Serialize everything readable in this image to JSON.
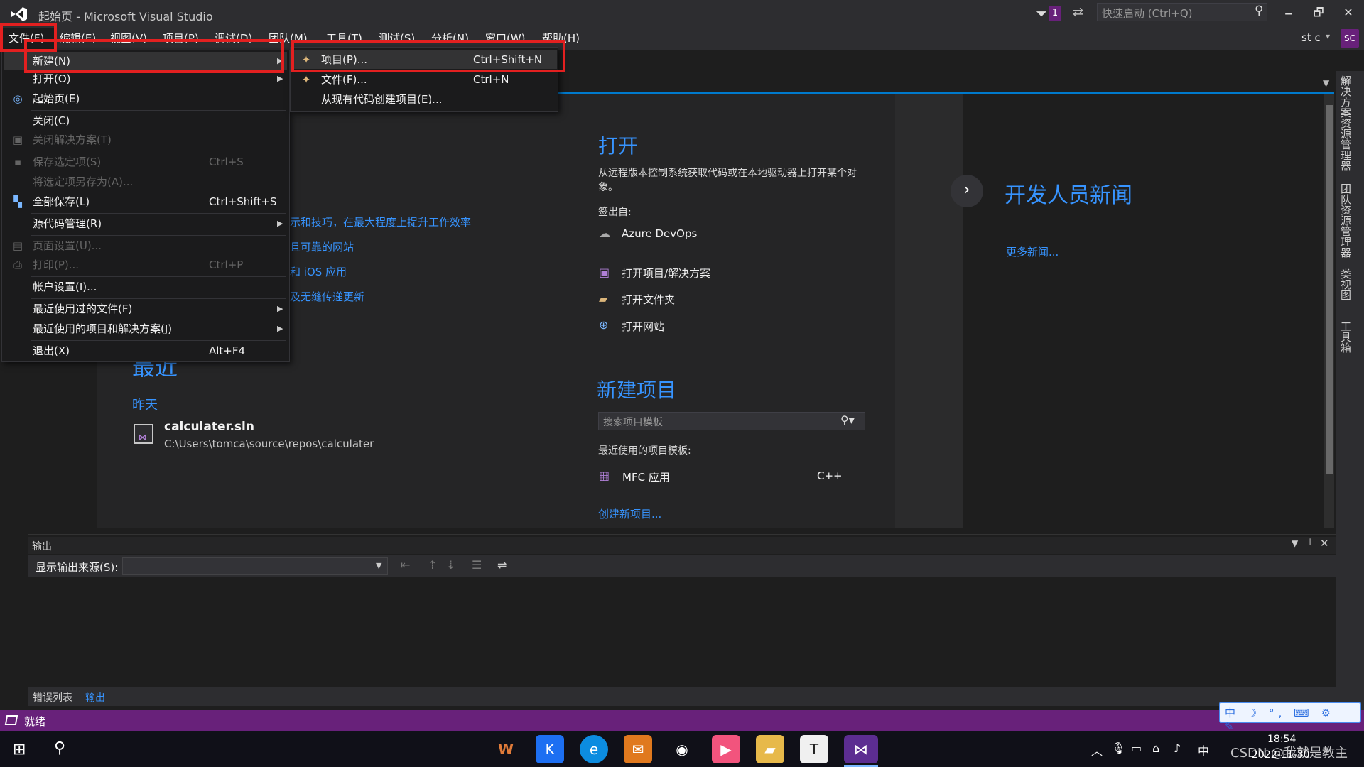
{
  "window": {
    "title": "起始页 - Microsoft Visual Studio",
    "notification_count": "1",
    "quick_launch_placeholder": "快速启动 (Ctrl+Q)",
    "minimize": "🗕",
    "restore": "🗗",
    "close": "✕"
  },
  "menubar": {
    "items": [
      "文件(F)",
      "编辑(E)",
      "视图(V)",
      "项目(P)",
      "调试(D)",
      "团队(M)",
      "工具(T)",
      "测试(S)",
      "分析(N)",
      "窗口(W)",
      "帮助(H)"
    ],
    "user_name": "st c",
    "avatar_initials": "SC"
  },
  "file_menu": {
    "items": [
      {
        "label": "新建(N)",
        "shortcut": "",
        "submenu": true,
        "disabled": false,
        "icon": ""
      },
      {
        "label": "打开(O)",
        "shortcut": "",
        "submenu": true,
        "disabled": false,
        "icon": ""
      },
      {
        "label": "起始页(E)",
        "shortcut": "",
        "submenu": false,
        "disabled": false,
        "icon": "start-page-icon"
      },
      {
        "label": "关闭(C)",
        "shortcut": "",
        "submenu": false,
        "disabled": false,
        "icon": ""
      },
      {
        "label": "关闭解决方案(T)",
        "shortcut": "",
        "submenu": false,
        "disabled": true,
        "icon": "close-solution-icon"
      },
      {
        "label": "保存选定项(S)",
        "shortcut": "Ctrl+S",
        "submenu": false,
        "disabled": true,
        "icon": "save-icon"
      },
      {
        "label": "将选定项另存为(A)...",
        "shortcut": "",
        "submenu": false,
        "disabled": true,
        "icon": ""
      },
      {
        "label": "全部保存(L)",
        "shortcut": "Ctrl+Shift+S",
        "submenu": false,
        "disabled": false,
        "icon": "save-all-icon"
      },
      {
        "label": "源代码管理(R)",
        "shortcut": "",
        "submenu": true,
        "disabled": false,
        "icon": ""
      },
      {
        "label": "页面设置(U)...",
        "shortcut": "",
        "submenu": false,
        "disabled": true,
        "icon": "page-setup-icon"
      },
      {
        "label": "打印(P)...",
        "shortcut": "Ctrl+P",
        "submenu": false,
        "disabled": true,
        "icon": "print-icon"
      },
      {
        "label": "帐户设置(I)...",
        "shortcut": "",
        "submenu": false,
        "disabled": false,
        "icon": ""
      },
      {
        "label": "最近使用过的文件(F)",
        "shortcut": "",
        "submenu": true,
        "disabled": false,
        "icon": ""
      },
      {
        "label": "最近使用的项目和解决方案(J)",
        "shortcut": "",
        "submenu": true,
        "disabled": false,
        "icon": ""
      },
      {
        "label": "退出(X)",
        "shortcut": "Alt+F4",
        "submenu": false,
        "disabled": false,
        "icon": ""
      }
    ]
  },
  "new_submenu": {
    "items": [
      {
        "label": "项目(P)...",
        "shortcut": "Ctrl+Shift+N"
      },
      {
        "label": "文件(F)...",
        "shortcut": "Ctrl+N"
      },
      {
        "label": "从现有代码创建项目(E)...",
        "shortcut": ""
      }
    ]
  },
  "start_page": {
    "partial_links": [
      "示和技巧，在最大程度上提升工作效率",
      "且可靠的网站",
      "和 iOS 应用",
      "及无缝传递更新"
    ],
    "recent_heading": "最近",
    "recent_group": "昨天",
    "recent_item": {
      "name": "calculater.sln",
      "path": "C:\\Users\\tomca\\source\\repos\\calculater"
    },
    "open": {
      "heading": "打开",
      "description": "从远程版本控制系统获取代码或在本地驱动器上打开某个对象。",
      "checkout_label": "签出自:",
      "azure": "Azure DevOps",
      "open_project": "打开项目/解决方案",
      "open_folder": "打开文件夹",
      "open_website": "打开网站"
    },
    "new_project": {
      "heading": "新建项目",
      "search_placeholder": "搜索项目模板",
      "recent_templates_label": "最近使用的项目模板:",
      "template_name": "MFC 应用",
      "template_lang": "C++",
      "create_link": "创建新项目..."
    },
    "news": {
      "heading": "开发人员新闻",
      "more_link": "更多新闻..."
    }
  },
  "right_rail": {
    "tabs": [
      "解决方案资源管理器",
      "团队资源管理器",
      "类视图",
      "工具箱"
    ]
  },
  "output": {
    "title": "输出",
    "source_label": "显示输出来源(S):",
    "source_value": ""
  },
  "bottom_tabs": [
    "错误列表",
    "输出"
  ],
  "status": {
    "text": "就绪"
  },
  "ime": {
    "text": "中 ☽ °, ⌨ ⚙ ✎"
  },
  "taskbar": {
    "time": "18:54",
    "date": "2022-11-30",
    "ime_lang": "中",
    "watermark": "CSDN @我就是教主"
  },
  "colors": {
    "accent": "#007acc",
    "vs_purple": "#68217a",
    "highlight_box": "#e32020",
    "link": "#3794ff"
  }
}
